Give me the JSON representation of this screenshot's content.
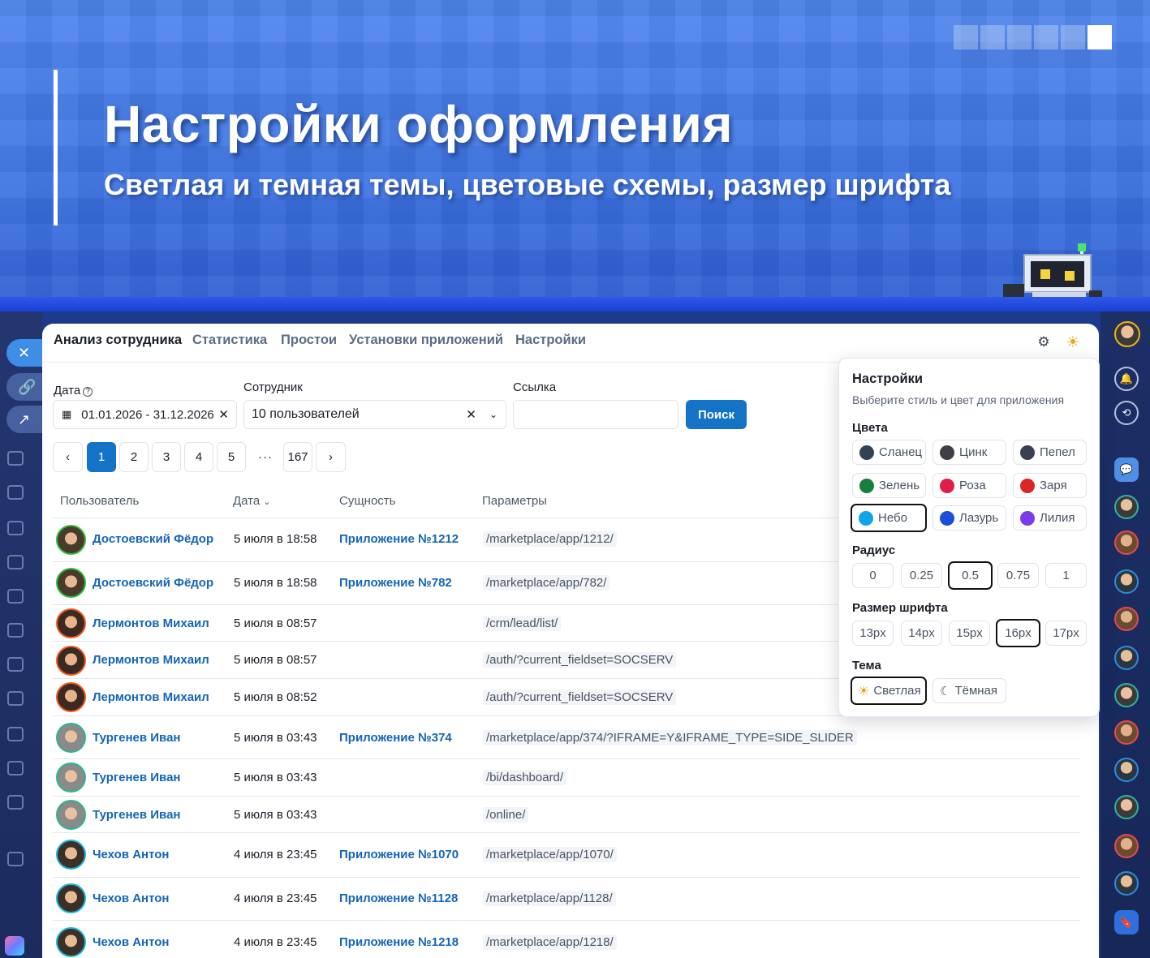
{
  "banner": {
    "title": "Настройки оформления",
    "subtitle": "Светлая и темная темы, цветовые схемы, размер шрифта"
  },
  "nav": {
    "tabs": [
      {
        "label": "Анализ сотрудника",
        "active": true
      },
      {
        "label": "Статистика",
        "active": false
      },
      {
        "label": "Простои",
        "active": false
      },
      {
        "label": "Установки приложений",
        "active": false
      },
      {
        "label": "Настройки",
        "active": false
      }
    ]
  },
  "filters": {
    "date_label": "Дата",
    "date_value": "01.01.2026 - 31.12.2026",
    "employee_label": "Сотрудник",
    "employee_value": "10 пользователей",
    "link_label": "Ссылка",
    "link_value": "",
    "search_button": "Поиск"
  },
  "pagination": {
    "pages": [
      "1",
      "2",
      "3",
      "4",
      "5",
      "···",
      "167"
    ],
    "current": "1"
  },
  "table": {
    "headers": {
      "user": "Пользователь",
      "date": "Дата",
      "entity": "Сущность",
      "params": "Параметры"
    },
    "rows": [
      {
        "user": "Достоевский Фёдор",
        "date": "5 июля в 18:58",
        "entity": "Приложение №1212",
        "params": "/marketplace/app/1212/",
        "avatar": "green"
      },
      {
        "user": "Достоевский Фёдор",
        "date": "5 июля в 18:58",
        "entity": "Приложение №782",
        "params": "/marketplace/app/782/",
        "avatar": "green"
      },
      {
        "user": "Лермонтов Михаил",
        "date": "5 июля в 08:57",
        "entity": "",
        "params": "/crm/lead/list/",
        "avatar": "orange"
      },
      {
        "user": "Лермонтов Михаил",
        "date": "5 июля в 08:57",
        "entity": "",
        "params": "/auth/?current_fieldset=SOCSERV",
        "avatar": "orange"
      },
      {
        "user": "Лермонтов Михаил",
        "date": "5 июля в 08:52",
        "entity": "",
        "params": "/auth/?current_fieldset=SOCSERV",
        "avatar": "orange"
      },
      {
        "user": "Тургенев Иван",
        "date": "5 июля в 03:43",
        "entity": "Приложение №374",
        "params": "/marketplace/app/374/?IFRAME=Y&IFRAME_TYPE=SIDE_SLIDER",
        "avatar": "teal"
      },
      {
        "user": "Тургенев Иван",
        "date": "5 июля в 03:43",
        "entity": "",
        "params": "/bi/dashboard/",
        "avatar": "teal"
      },
      {
        "user": "Тургенев Иван",
        "date": "5 июля в 03:43",
        "entity": "",
        "params": "/online/",
        "avatar": "teal"
      },
      {
        "user": "Чехов Антон",
        "date": "4 июля в 23:45",
        "entity": "Приложение №1070",
        "params": "/marketplace/app/1070/",
        "avatar": "cyan"
      },
      {
        "user": "Чехов Антон",
        "date": "4 июля в 23:45",
        "entity": "Приложение №1128",
        "params": "/marketplace/app/1128/",
        "avatar": "cyan"
      },
      {
        "user": "Чехов Антон",
        "date": "4 июля в 23:45",
        "entity": "Приложение №1218",
        "params": "/marketplace/app/1218/",
        "avatar": "cyan"
      }
    ]
  },
  "settings": {
    "title": "Настройки",
    "description": "Выберите стиль и цвет для приложения",
    "colors_label": "Цвета",
    "colors": [
      {
        "name": "Сланец",
        "color": "#334155",
        "selected": false
      },
      {
        "name": "Цинк",
        "color": "#3f3f46",
        "selected": false
      },
      {
        "name": "Пепел",
        "color": "#374151",
        "selected": false
      },
      {
        "name": "Зелень",
        "color": "#15803d",
        "selected": false
      },
      {
        "name": "Роза",
        "color": "#e11d48",
        "selected": false
      },
      {
        "name": "Заря",
        "color": "#dc2626",
        "selected": false
      },
      {
        "name": "Небо",
        "color": "#0ea5e9",
        "selected": true
      },
      {
        "name": "Лазурь",
        "color": "#1d4ed8",
        "selected": false
      },
      {
        "name": "Лилия",
        "color": "#7c3aed",
        "selected": false
      }
    ],
    "radius_label": "Радиус",
    "radius_options": [
      "0",
      "0.25",
      "0.5",
      "0.75",
      "1"
    ],
    "radius_selected": "0.5",
    "font_label": "Размер шрифта",
    "font_options": [
      "13px",
      "14px",
      "15px",
      "16px",
      "17px"
    ],
    "font_selected": "16px",
    "theme_label": "Тема",
    "themes": [
      {
        "name": "Светлая",
        "icon": "sun-icon",
        "selected": true
      },
      {
        "name": "Тёмная",
        "icon": "moon-icon",
        "selected": false
      }
    ]
  },
  "colors": {
    "accent": "#1573c7",
    "link": "#1565b8",
    "banner": "#4a80e9"
  }
}
